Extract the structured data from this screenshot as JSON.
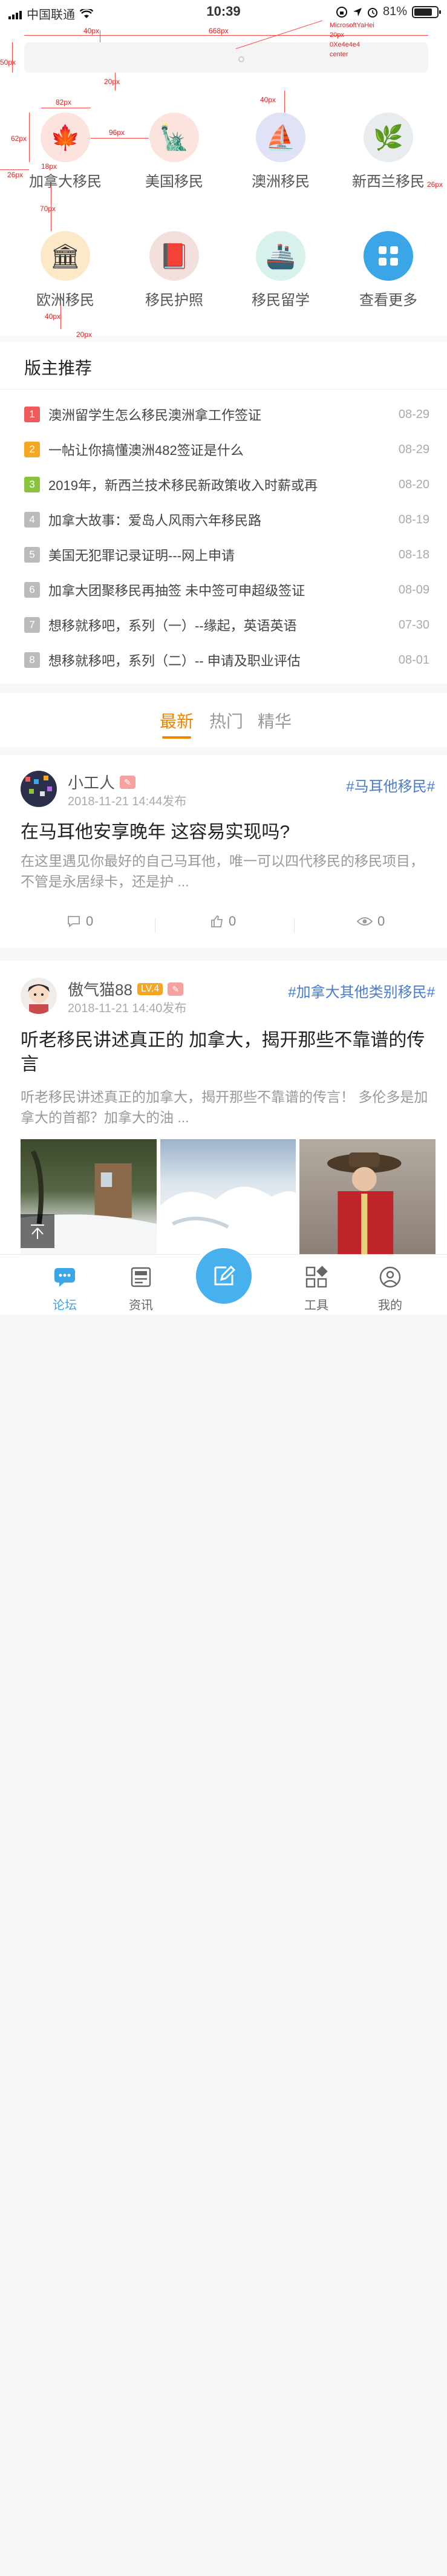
{
  "status_bar": {
    "carrier": "中国联通",
    "time": "10:39",
    "battery": "81%",
    "battery_level": 0.81
  },
  "search": {
    "placeholder": ""
  },
  "annotations": {
    "top_40": "40px",
    "width_668": "668px",
    "height_50": "50px",
    "note_font": "MicrosoftYaHei",
    "note_size": "20px",
    "note_color": "0Xe4e4e4",
    "note_align": "center",
    "gap_20a": "20px",
    "icon_82": "82px",
    "gap_96": "96px",
    "gap_40b": "40px",
    "left_62": "62px",
    "left_26": "26px",
    "right_26": "26px",
    "gap_18": "18px",
    "gap_70": "70px",
    "gap_40c": "40px",
    "gap_20b": "20px"
  },
  "categories": [
    {
      "label": "加拿大移民",
      "icon": "maple-leaf-icon",
      "bg": "#fde3de",
      "glyph": "🍁"
    },
    {
      "label": "美国移民",
      "icon": "statue-of-liberty-icon",
      "bg": "#fde3de",
      "glyph": "🗽"
    },
    {
      "label": "澳洲移民",
      "icon": "sydney-opera-icon",
      "bg": "#dfe3f5",
      "glyph": "⛵"
    },
    {
      "label": "新西兰移民",
      "icon": "fern-icon",
      "bg": "#e8ecef",
      "glyph": "🌿"
    },
    {
      "label": "欧洲移民",
      "icon": "colosseum-icon",
      "bg": "#fde8c8",
      "glyph": "🏛"
    },
    {
      "label": "移民护照",
      "icon": "passport-icon",
      "bg": "#f3e0de",
      "glyph": "📕"
    },
    {
      "label": "移民留学",
      "icon": "ship-icon",
      "bg": "#d7f1ec",
      "glyph": "🚢"
    },
    {
      "label": "查看更多",
      "icon": "grid-more-icon",
      "bg": "#3aa6e8",
      "glyph": ""
    }
  ],
  "recommend": {
    "title": "版主推荐",
    "items": [
      {
        "num": "1",
        "text": "澳洲留学生怎么移民澳洲拿工作签证",
        "date": "08-29",
        "color": "#f05a5a"
      },
      {
        "num": "2",
        "text": "一帖让你搞懂澳洲482签证是什么",
        "date": "08-29",
        "color": "#f5a623"
      },
      {
        "num": "3",
        "text": "2019年，新西兰技术移民新政策收入时薪或再",
        "date": "08-20",
        "color": "#8ac43f"
      },
      {
        "num": "4",
        "text": "加拿大故事：爱岛人风雨六年移民路",
        "date": "08-19",
        "color": "#bbbbbb"
      },
      {
        "num": "5",
        "text": "美国无犯罪记录证明---网上申请",
        "date": "08-18",
        "color": "#bbbbbb"
      },
      {
        "num": "6",
        "text": "加拿大团聚移民再抽签 未中签可申超级签证",
        "date": "08-09",
        "color": "#bbbbbb"
      },
      {
        "num": "7",
        "text": "想移就移吧，系列（一）--缘起，英语英语",
        "date": "07-30",
        "color": "#bbbbbb"
      },
      {
        "num": "8",
        "text": "想移就移吧，系列（二）-- 申请及职业评估",
        "date": "08-01",
        "color": "#bbbbbb"
      }
    ]
  },
  "tabs": [
    "最新",
    "热门",
    "精华"
  ],
  "posts": [
    {
      "author": "小工人",
      "level": "",
      "time": "2018-11-21 14:44发布",
      "tag": "#马耳他移民#",
      "title": "在马耳他安享晚年 这容易实现吗?",
      "summary": "在这里遇见你最好的自己马耳他，唯一可以四代移民的移民项目，不管是永居绿卡，还是护 ...",
      "comments": "0",
      "likes": "0",
      "views": "0"
    },
    {
      "author": "傲气猫88",
      "level": "LV.4",
      "time": "2018-11-21 14:40发布",
      "tag": "#加拿大其他类别移民#",
      "title": "听老移民讲述真正的 加拿大，揭开那些不靠谱的传言",
      "summary": "听老移民讲述真正的加拿大，揭开那些不靠谱的传言！ 多伦多是加拿大的首都？加拿大的油 ..."
    }
  ],
  "tabbar": {
    "items": [
      {
        "label": "论坛",
        "icon": "forum-icon"
      },
      {
        "label": "资讯",
        "icon": "news-icon"
      },
      {
        "label": "工具",
        "icon": "tools-icon"
      },
      {
        "label": "我的",
        "icon": "profile-icon"
      }
    ],
    "compose_icon": "compose-icon"
  },
  "colors": {
    "accent": "#f08300",
    "primary_blue": "#3aa6e8",
    "tag_blue": "#4a7cc9",
    "annotation_red": "#e02020"
  }
}
